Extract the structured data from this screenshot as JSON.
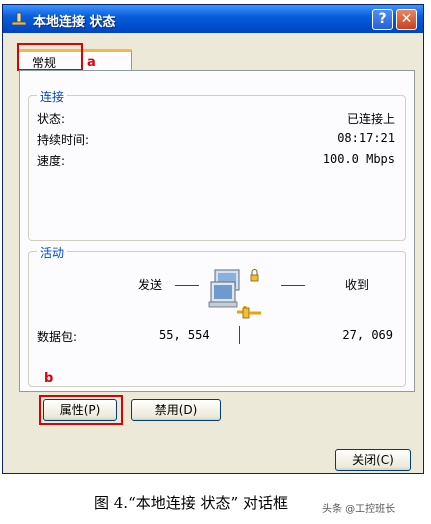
{
  "window": {
    "title": "本地连接 状态",
    "help_glyph": "?",
    "close_glyph": "✕"
  },
  "tabs": [
    {
      "label": "常规",
      "active": true
    }
  ],
  "annotations": {
    "marker_a": "a",
    "marker_b": "b",
    "color": "#e00000"
  },
  "connection": {
    "legend": "连接",
    "rows": [
      {
        "label": "状态:",
        "value": "已连接上"
      },
      {
        "label": "持续时间:",
        "value": "08:17:21"
      },
      {
        "label": "速度:",
        "value": "100.0 Mbps"
      }
    ]
  },
  "activity": {
    "legend": "活动",
    "sent_label": "发送",
    "received_label": "收到",
    "packets_label": "数据包:",
    "packets_sent": "55, 554",
    "packets_received": "27, 069",
    "icon": "network-computers-icon"
  },
  "buttons": {
    "properties": "属性(P)",
    "disable": "禁用(D)",
    "close": "关闭(C)"
  },
  "caption": "图 4.“本地连接 状态” 对话框",
  "watermark": "头条 @工控班长",
  "colors": {
    "titlebar": "#0050d0",
    "legend_text": "#0046d5",
    "dialog_bg": "#ece9d8"
  }
}
